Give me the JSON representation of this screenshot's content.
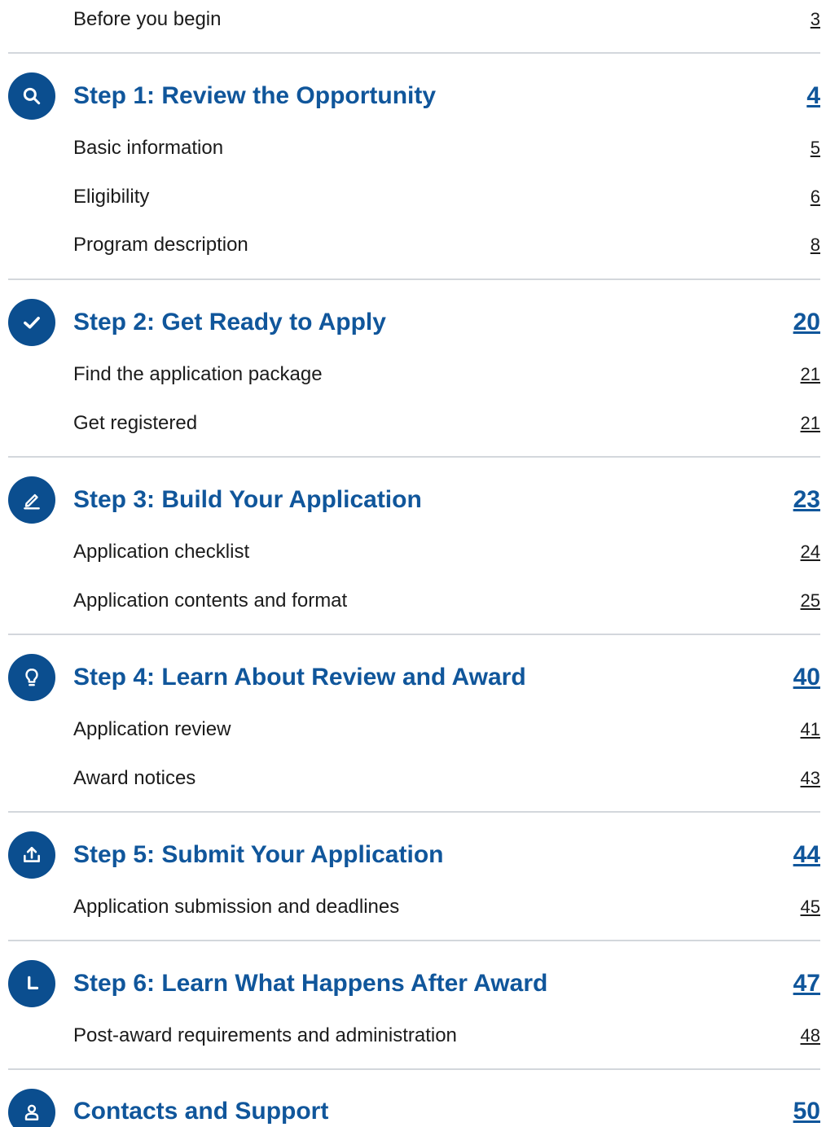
{
  "toc": {
    "intro": {
      "label": "Before you begin",
      "page": "3"
    },
    "steps": [
      {
        "title": "Step 1: Review the Opportunity",
        "page": "4",
        "icon": "search-icon",
        "items": [
          {
            "label": "Basic information",
            "page": "5"
          },
          {
            "label": "Eligibility",
            "page": "6"
          },
          {
            "label": "Program description",
            "page": "8"
          }
        ]
      },
      {
        "title": "Step 2: Get Ready to Apply",
        "page": "20",
        "icon": "checkmark-icon",
        "items": [
          {
            "label": "Find the application package",
            "page": "21"
          },
          {
            "label": "Get registered",
            "page": "21"
          }
        ]
      },
      {
        "title": "Step 3: Build Your Application",
        "page": "23",
        "icon": "pencil-icon",
        "items": [
          {
            "label": "Application checklist",
            "page": "24"
          },
          {
            "label": "Application contents and format",
            "page": "25"
          }
        ]
      },
      {
        "title": "Step 4: Learn About Review and Award",
        "page": "40",
        "icon": "lightbulb-icon",
        "items": [
          {
            "label": "Application review",
            "page": "41"
          },
          {
            "label": "Award notices",
            "page": "43"
          }
        ]
      },
      {
        "title": "Step 5: Submit Your Application",
        "page": "44",
        "icon": "upload-icon",
        "items": [
          {
            "label": "Application submission and deadlines",
            "page": "45"
          }
        ]
      },
      {
        "title": "Step 6: Learn What Happens After Award",
        "page": "47",
        "icon": "clock-icon",
        "items": [
          {
            "label": "Post-award requirements and administration",
            "page": "48"
          }
        ]
      },
      {
        "title": "Contacts and Support",
        "page": "50",
        "icon": "person-icon",
        "items": []
      }
    ]
  },
  "colors": {
    "heading": "#10569b",
    "icon_bg": "#0b4e8f",
    "divider": "#d3d7dc",
    "text": "#1b1b1b"
  }
}
